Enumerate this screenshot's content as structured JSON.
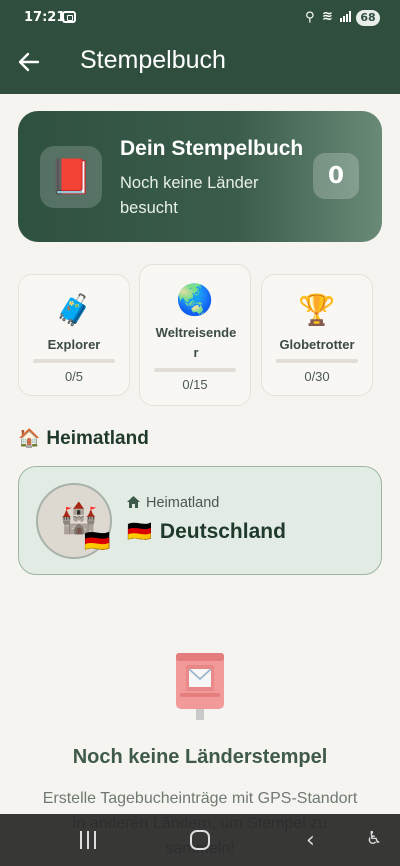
{
  "status_bar": {
    "time": "17:21",
    "battery": "68",
    "icons": [
      "screenshot-icon",
      "location-icon",
      "wifi-icon",
      "signal-icon",
      "battery-icon"
    ]
  },
  "app_bar": {
    "title": "Stempelbuch",
    "back_icon": "arrow-left-icon"
  },
  "summary": {
    "icon": "book-icon",
    "title": "Dein Stempelbuch",
    "subtitle": "Noch keine Länder besucht",
    "count": "0"
  },
  "achievements": [
    {
      "icon": "luggage-icon",
      "name": "Explorer",
      "progress_text": "0/5",
      "progress": 0
    },
    {
      "icon": "globe-icon",
      "name": "Weltreisender",
      "progress_text": "0/15",
      "progress": 0
    },
    {
      "icon": "trophy-icon",
      "name": "Globetrotter",
      "progress_text": "0/30",
      "progress": 0
    }
  ],
  "homeland": {
    "section_icon": "house-icon",
    "section_title": "Heimatland",
    "label_icon": "home-icon",
    "label": "Heimatland",
    "country": "Deutschland",
    "flag": "germany-flag-icon",
    "stamp_icon": "castle-icon"
  },
  "empty_state": {
    "icon": "mailbox-icon",
    "title": "Noch keine Länderstempel",
    "text": "Erstelle Tagebucheinträge mit GPS-Standort in anderen Ländern, um Stempel zu sammeln!"
  },
  "nav_bar": {
    "items": [
      "recents-icon",
      "home-icon",
      "back-icon",
      "accessibility-icon"
    ]
  },
  "colors": {
    "primary": "#2f4e3e",
    "background": "#f6f4f0",
    "card_home": "#e2ebe4",
    "accent_border": "#9db5a5"
  }
}
